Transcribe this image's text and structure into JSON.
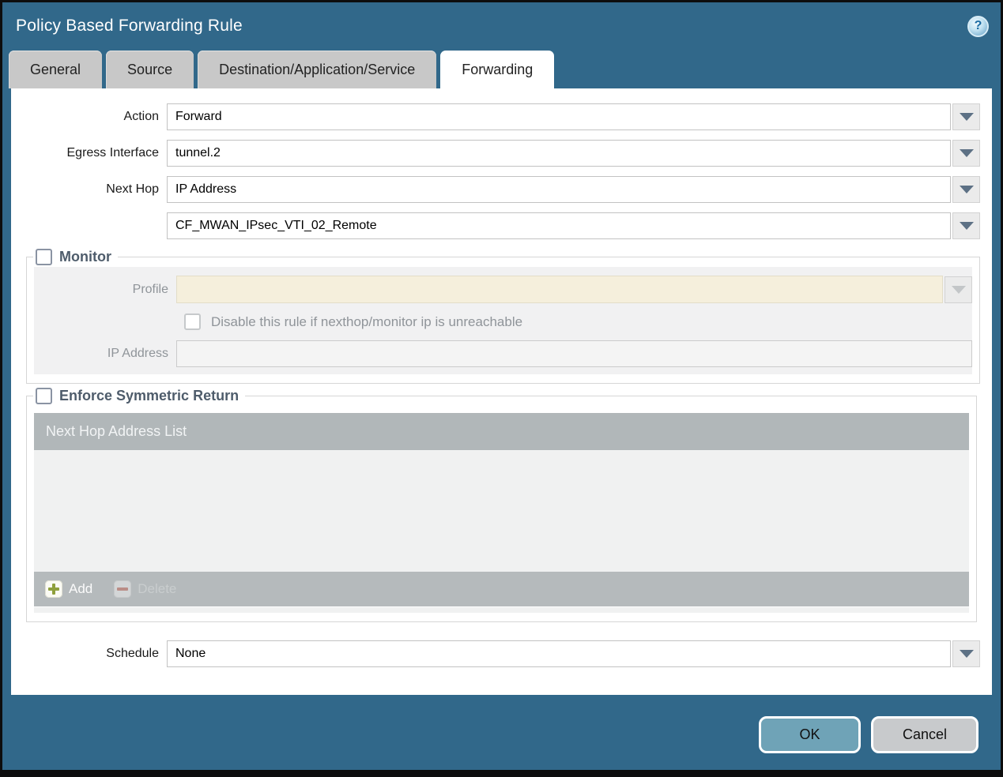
{
  "dialog": {
    "title": "Policy Based Forwarding Rule"
  },
  "icons": {
    "help": "?"
  },
  "tabs": [
    {
      "label": "General"
    },
    {
      "label": "Source"
    },
    {
      "label": "Destination/Application/Service"
    },
    {
      "label": "Forwarding"
    }
  ],
  "form": {
    "action": {
      "label": "Action",
      "value": "Forward"
    },
    "egress_interface": {
      "label": "Egress Interface",
      "value": "tunnel.2"
    },
    "next_hop": {
      "label": "Next Hop",
      "value": "IP Address"
    },
    "next_hop_address": {
      "value": "CF_MWAN_IPsec_VTI_02_Remote"
    },
    "schedule": {
      "label": "Schedule",
      "value": "None"
    }
  },
  "monitor": {
    "title": "Monitor",
    "checked": false,
    "profile_label": "Profile",
    "profile_value": "",
    "disable_checkbox_label": "Disable this rule if nexthop/monitor ip is unreachable",
    "ip_address_label": "IP Address",
    "ip_address_value": ""
  },
  "symmetric_return": {
    "title": "Enforce Symmetric Return",
    "checked": false,
    "table_header": "Next Hop Address List",
    "rows": [],
    "add_label": "Add",
    "delete_label": "Delete"
  },
  "footer": {
    "ok_label": "OK",
    "cancel_label": "Cancel"
  },
  "colors": {
    "dialog_background": "#31688a",
    "active_tab": "#ffffff",
    "inactive_tab": "#c8c8c8",
    "disabled_field": "#f5efdc",
    "table_header": "#b1b7b9",
    "ok_button": "#6fa3b7",
    "cancel_button": "#c8cacc",
    "section_title": "#4e5c6b"
  }
}
